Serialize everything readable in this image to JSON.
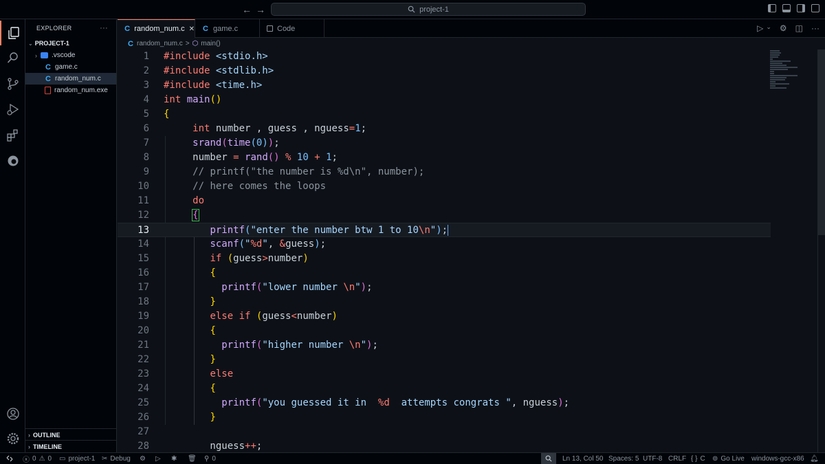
{
  "titlebar": {
    "search_text": "project-1"
  },
  "sidebar": {
    "title": "EXPLORER",
    "more": "···",
    "project": "PROJECT-1",
    "items": [
      {
        "label": ".vscode"
      },
      {
        "label": "game.c"
      },
      {
        "label": "random_num.c"
      },
      {
        "label": "random_num.exe"
      }
    ],
    "outline": "OUTLINE",
    "timeline": "TIMELINE"
  },
  "tabs": [
    {
      "label": "random_num.c",
      "close": "✕"
    },
    {
      "label": "game.c"
    },
    {
      "label": "Code"
    }
  ],
  "breadcrumb": {
    "file": "random_num.c",
    "sep": ">",
    "symbol": "main()"
  },
  "editor": {
    "line_numbers": [
      "1",
      "2",
      "3",
      "4",
      "5",
      "6",
      "7",
      "8",
      "9",
      "10",
      "11",
      "12",
      "13",
      "14",
      "15",
      "16",
      "17",
      "18",
      "19",
      "20",
      "21",
      "22",
      "23",
      "24",
      "25",
      "26",
      "27",
      "28"
    ],
    "current_line": 13
  },
  "status": {
    "errors": "0",
    "warnings": "0",
    "project": "project-1",
    "debug": "Debug",
    "ports": "0",
    "position": "Ln 13, Col 50",
    "spaces": "Spaces: 5",
    "encoding": "UTF-8",
    "eol": "CRLF",
    "language": "C",
    "go_live": "Go Live",
    "config": "windows-gcc-x86"
  },
  "colors": {
    "keyword": "#ff7b72",
    "string": "#a5d6ff",
    "number": "#79c0ff",
    "function": "#d2a8ff",
    "comment": "#8b949e",
    "accent": "#f78166",
    "c_icon": "#3fa9f5"
  }
}
